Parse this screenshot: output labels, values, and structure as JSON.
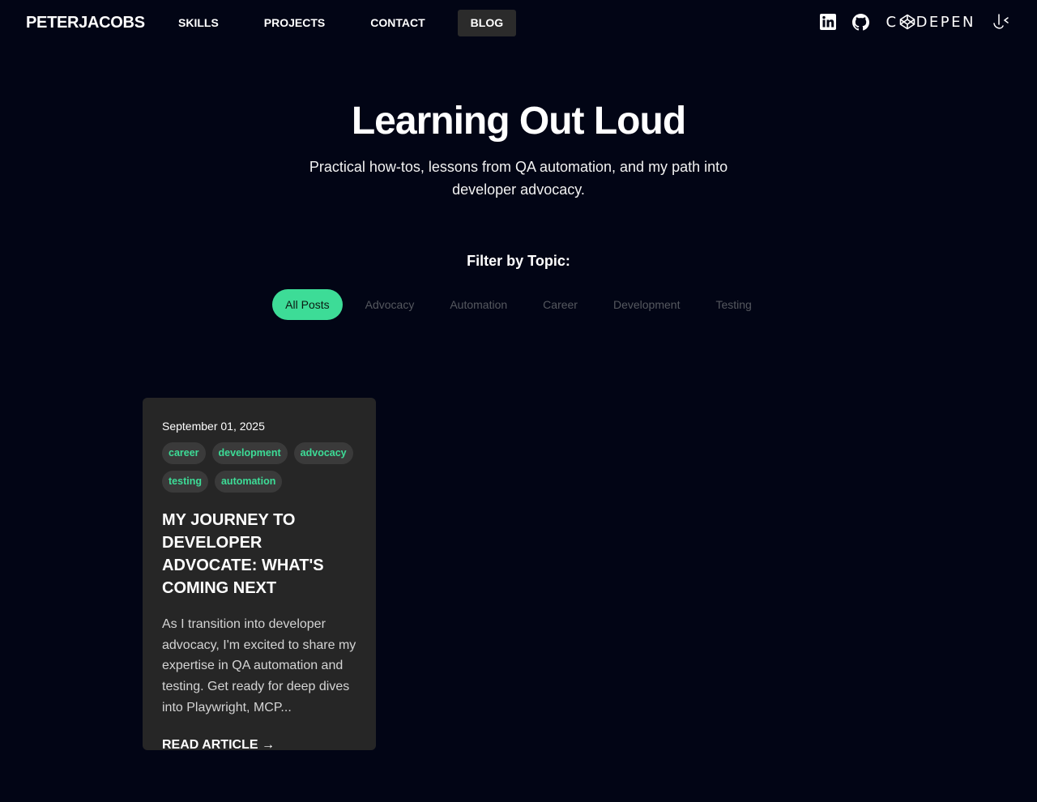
{
  "nav": {
    "brand": "PETERJACOBS",
    "links": [
      {
        "label": "SKILLS"
      },
      {
        "label": "PROJECTS"
      },
      {
        "label": "CONTACT"
      },
      {
        "label": "BLOG",
        "active": true
      }
    ],
    "socials": [
      {
        "icon": "linkedin-icon"
      },
      {
        "icon": "github-icon"
      },
      {
        "icon": "codepen-icon",
        "text_left": "C",
        "text_right": "DEPEN"
      },
      {
        "icon": "ko-fi-icon"
      }
    ]
  },
  "hero": {
    "title": "Learning Out Loud",
    "subtitle": "Practical how-tos, lessons from QA automation, and my path into developer advocacy."
  },
  "filter": {
    "title": "Filter by Topic:",
    "options": [
      "All Posts",
      "Advocacy",
      "Automation",
      "Career",
      "Development",
      "Testing"
    ],
    "selected": "All Posts"
  },
  "posts": [
    {
      "date": "September 01, 2025",
      "tags": [
        "career",
        "development",
        "advocacy",
        "testing",
        "automation"
      ],
      "title": "My Journey to Developer Advocate: What's Coming Next",
      "excerpt": "As I transition into developer advocacy, I'm excited to share my expertise in QA automation and testing. Get ready for deep dives into Playwright, MCP...",
      "cta": "READ ARTICLE →"
    }
  ],
  "colors": {
    "background": "#020515",
    "accent": "#3ddc97",
    "card": "#262626",
    "tag_bg": "#3a3a3a",
    "nav_active_bg": "#2b2b2b"
  }
}
